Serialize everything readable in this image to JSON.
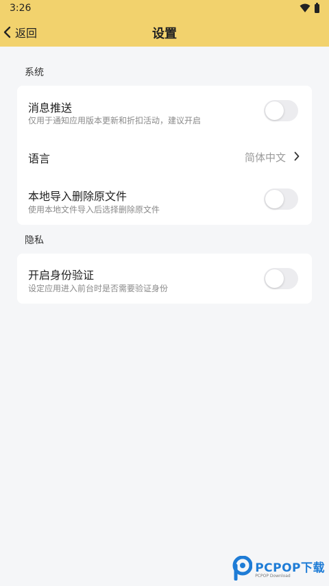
{
  "status_bar": {
    "time": "3:26"
  },
  "header": {
    "back_label": "返回",
    "title": "设置"
  },
  "sections": [
    {
      "title": "系统",
      "rows": [
        {
          "title": "消息推送",
          "desc": "仅用于通知应用版本更新和折扣活动，建议开启",
          "toggle_on": false
        },
        {
          "title": "语言",
          "value": "简体中文"
        },
        {
          "title": "本地导入删除原文件",
          "desc": "使用本地文件导入后选择删除原文件",
          "toggle_on": false
        }
      ]
    },
    {
      "title": "隐私",
      "rows": [
        {
          "title": "开启身份验证",
          "desc": "设定应用进入前台时是否需要验证身份",
          "toggle_on": false
        }
      ]
    }
  ],
  "watermark": {
    "text": "PCPOP下载",
    "sub": "PCPOP Download"
  },
  "colors": {
    "header_bg": "#f2d26d",
    "page_bg": "#f5f6f8",
    "card_bg": "#ffffff",
    "toggle_off": "#ececef",
    "watermark": "#1e7cd6"
  }
}
